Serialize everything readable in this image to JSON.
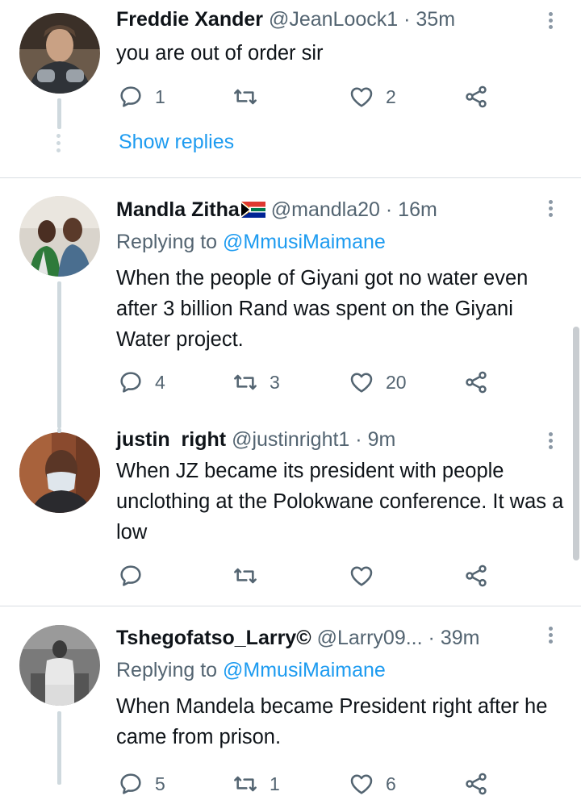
{
  "tweets": [
    {
      "name": "Freddie Xander",
      "handle": "@JeanLoock1",
      "time": "35m",
      "text": "you are out of order sir",
      "reply_count": "1",
      "retweet_count": "",
      "like_count": "2",
      "show_replies": "Show replies"
    },
    {
      "name": "Mandla Zitha",
      "handle": "@mandla20",
      "time": "16m",
      "replying_prefix": "Replying to",
      "replying_to": "@MmusiMaimane",
      "text": "When the people of Giyani got no water even after 3 billion Rand was spent on the Giyani Water project.",
      "reply_count": "4",
      "retweet_count": "3",
      "like_count": "20"
    },
    {
      "name": "justin  right",
      "handle": "@justinright1",
      "time": "9m",
      "text": "When JZ became its president with people unclothing at the Polokwane conference. It was a low",
      "reply_count": "",
      "retweet_count": "",
      "like_count": ""
    },
    {
      "name": "Tshegofatso_Larry©",
      "handle": "@Larry09...",
      "time": "39m",
      "replying_prefix": "Replying to",
      "replying_to": "@MmusiMaimane",
      "text": "When Mandela became President right after he came from prison.",
      "reply_count": "5",
      "retweet_count": "1",
      "like_count": "6"
    }
  ],
  "dot": "·",
  "colors": {
    "accent": "#1d9bf0",
    "secondary": "#536471"
  },
  "icons": [
    "reply-icon",
    "retweet-icon",
    "like-icon",
    "share-icon",
    "more-icon",
    "south-africa-flag-icon"
  ]
}
